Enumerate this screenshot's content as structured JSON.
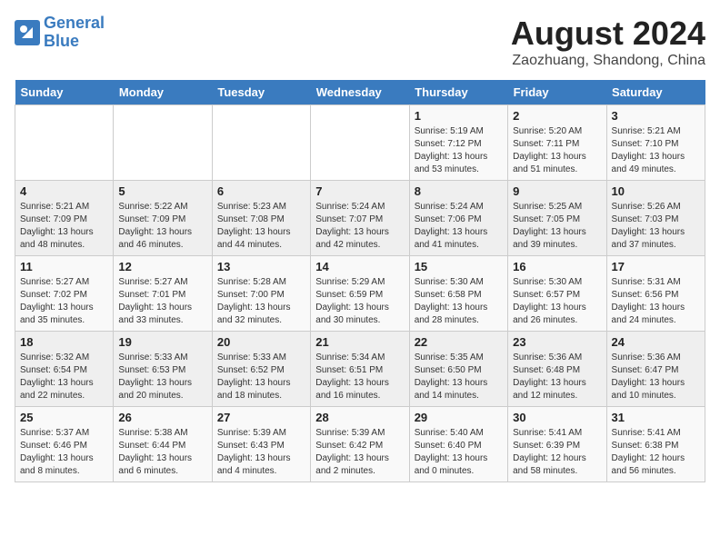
{
  "header": {
    "logo_line1": "General",
    "logo_line2": "Blue",
    "main_title": "August 2024",
    "sub_title": "Zaozhuang, Shandong, China"
  },
  "days_of_week": [
    "Sunday",
    "Monday",
    "Tuesday",
    "Wednesday",
    "Thursday",
    "Friday",
    "Saturday"
  ],
  "weeks": [
    [
      {
        "day": "",
        "info": ""
      },
      {
        "day": "",
        "info": ""
      },
      {
        "day": "",
        "info": ""
      },
      {
        "day": "",
        "info": ""
      },
      {
        "day": "1",
        "info": "Sunrise: 5:19 AM\nSunset: 7:12 PM\nDaylight: 13 hours\nand 53 minutes."
      },
      {
        "day": "2",
        "info": "Sunrise: 5:20 AM\nSunset: 7:11 PM\nDaylight: 13 hours\nand 51 minutes."
      },
      {
        "day": "3",
        "info": "Sunrise: 5:21 AM\nSunset: 7:10 PM\nDaylight: 13 hours\nand 49 minutes."
      }
    ],
    [
      {
        "day": "4",
        "info": "Sunrise: 5:21 AM\nSunset: 7:09 PM\nDaylight: 13 hours\nand 48 minutes."
      },
      {
        "day": "5",
        "info": "Sunrise: 5:22 AM\nSunset: 7:09 PM\nDaylight: 13 hours\nand 46 minutes."
      },
      {
        "day": "6",
        "info": "Sunrise: 5:23 AM\nSunset: 7:08 PM\nDaylight: 13 hours\nand 44 minutes."
      },
      {
        "day": "7",
        "info": "Sunrise: 5:24 AM\nSunset: 7:07 PM\nDaylight: 13 hours\nand 42 minutes."
      },
      {
        "day": "8",
        "info": "Sunrise: 5:24 AM\nSunset: 7:06 PM\nDaylight: 13 hours\nand 41 minutes."
      },
      {
        "day": "9",
        "info": "Sunrise: 5:25 AM\nSunset: 7:05 PM\nDaylight: 13 hours\nand 39 minutes."
      },
      {
        "day": "10",
        "info": "Sunrise: 5:26 AM\nSunset: 7:03 PM\nDaylight: 13 hours\nand 37 minutes."
      }
    ],
    [
      {
        "day": "11",
        "info": "Sunrise: 5:27 AM\nSunset: 7:02 PM\nDaylight: 13 hours\nand 35 minutes."
      },
      {
        "day": "12",
        "info": "Sunrise: 5:27 AM\nSunset: 7:01 PM\nDaylight: 13 hours\nand 33 minutes."
      },
      {
        "day": "13",
        "info": "Sunrise: 5:28 AM\nSunset: 7:00 PM\nDaylight: 13 hours\nand 32 minutes."
      },
      {
        "day": "14",
        "info": "Sunrise: 5:29 AM\nSunset: 6:59 PM\nDaylight: 13 hours\nand 30 minutes."
      },
      {
        "day": "15",
        "info": "Sunrise: 5:30 AM\nSunset: 6:58 PM\nDaylight: 13 hours\nand 28 minutes."
      },
      {
        "day": "16",
        "info": "Sunrise: 5:30 AM\nSunset: 6:57 PM\nDaylight: 13 hours\nand 26 minutes."
      },
      {
        "day": "17",
        "info": "Sunrise: 5:31 AM\nSunset: 6:56 PM\nDaylight: 13 hours\nand 24 minutes."
      }
    ],
    [
      {
        "day": "18",
        "info": "Sunrise: 5:32 AM\nSunset: 6:54 PM\nDaylight: 13 hours\nand 22 minutes."
      },
      {
        "day": "19",
        "info": "Sunrise: 5:33 AM\nSunset: 6:53 PM\nDaylight: 13 hours\nand 20 minutes."
      },
      {
        "day": "20",
        "info": "Sunrise: 5:33 AM\nSunset: 6:52 PM\nDaylight: 13 hours\nand 18 minutes."
      },
      {
        "day": "21",
        "info": "Sunrise: 5:34 AM\nSunset: 6:51 PM\nDaylight: 13 hours\nand 16 minutes."
      },
      {
        "day": "22",
        "info": "Sunrise: 5:35 AM\nSunset: 6:50 PM\nDaylight: 13 hours\nand 14 minutes."
      },
      {
        "day": "23",
        "info": "Sunrise: 5:36 AM\nSunset: 6:48 PM\nDaylight: 13 hours\nand 12 minutes."
      },
      {
        "day": "24",
        "info": "Sunrise: 5:36 AM\nSunset: 6:47 PM\nDaylight: 13 hours\nand 10 minutes."
      }
    ],
    [
      {
        "day": "25",
        "info": "Sunrise: 5:37 AM\nSunset: 6:46 PM\nDaylight: 13 hours\nand 8 minutes."
      },
      {
        "day": "26",
        "info": "Sunrise: 5:38 AM\nSunset: 6:44 PM\nDaylight: 13 hours\nand 6 minutes."
      },
      {
        "day": "27",
        "info": "Sunrise: 5:39 AM\nSunset: 6:43 PM\nDaylight: 13 hours\nand 4 minutes."
      },
      {
        "day": "28",
        "info": "Sunrise: 5:39 AM\nSunset: 6:42 PM\nDaylight: 13 hours\nand 2 minutes."
      },
      {
        "day": "29",
        "info": "Sunrise: 5:40 AM\nSunset: 6:40 PM\nDaylight: 13 hours\nand 0 minutes."
      },
      {
        "day": "30",
        "info": "Sunrise: 5:41 AM\nSunset: 6:39 PM\nDaylight: 12 hours\nand 58 minutes."
      },
      {
        "day": "31",
        "info": "Sunrise: 5:41 AM\nSunset: 6:38 PM\nDaylight: 12 hours\nand 56 minutes."
      }
    ]
  ]
}
